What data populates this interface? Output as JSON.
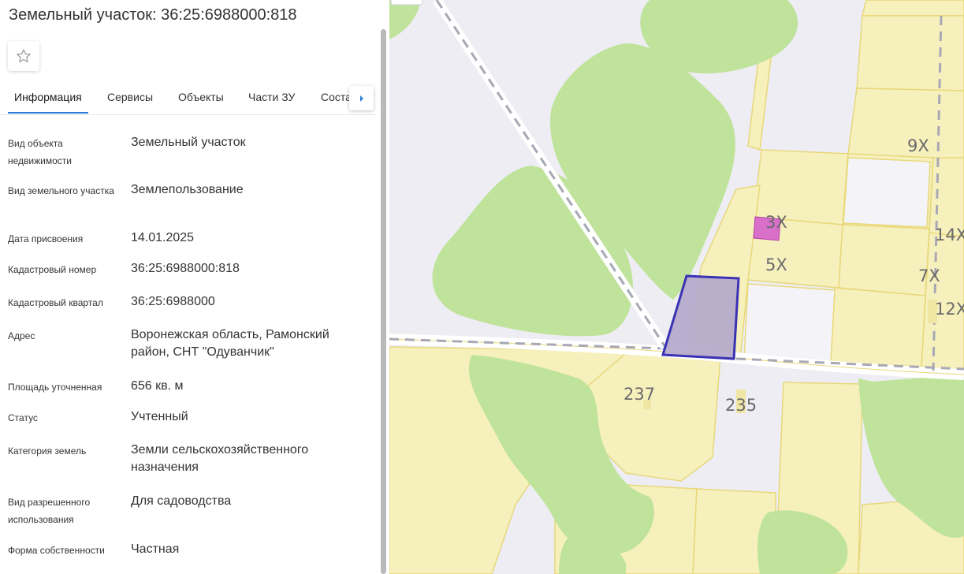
{
  "panel": {
    "title": "Земельный участок: 36:25:6988000:818",
    "favorite_icon": "star-outline-icon",
    "tabs": [
      {
        "label": "Информация",
        "active": true
      },
      {
        "label": "Сервисы"
      },
      {
        "label": "Объекты"
      },
      {
        "label": "Части ЗУ"
      },
      {
        "label": "Состав ЗУ"
      }
    ],
    "tabs_next_icon": "caret-right-icon",
    "info": [
      {
        "label": "Вид объекта недвижимости",
        "value": "Земельный участок"
      },
      {
        "label": "Вид земельного участка",
        "value": "Землепользование"
      },
      {
        "label": "Дата присвоения",
        "value": "14.01.2025"
      },
      {
        "label": "Кадастровый номер",
        "value": "36:25:6988000:818"
      },
      {
        "label": "Кадастровый квартал",
        "value": "36:25:6988000"
      },
      {
        "label": "Адрес",
        "value": "Воронежская область, Рамонский район, СНТ \"Одуванчик\""
      },
      {
        "label": "Площадь уточненная",
        "value": "656 кв. м"
      },
      {
        "label": "Статус",
        "value": "Учтенный"
      },
      {
        "label": "Категория земель",
        "value": "Земли сельскохозяйственного назначения"
      },
      {
        "label": "Вид разрешенного использования",
        "value": "Для садоводства"
      },
      {
        "label": "Форма собственности",
        "value": "Частная"
      }
    ]
  },
  "map": {
    "parcel_labels": [
      "9Х",
      "3Х",
      "14Х",
      "5Х",
      "7Х",
      "12Х",
      "237",
      "235"
    ],
    "colors": {
      "background": "#ededf3",
      "forest": "#bfe39a",
      "parcel_fill": "#f6f0bd",
      "parcel_border": "#e8d87a",
      "selected_fill": "#b6abcb",
      "selected_border": "#3a32b5",
      "highlight_fill": "#d86fc9"
    }
  }
}
